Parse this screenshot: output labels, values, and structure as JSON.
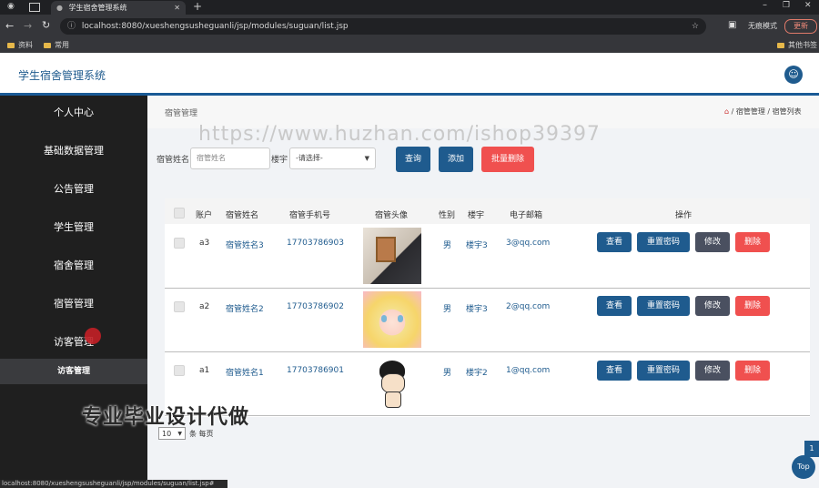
{
  "browser": {
    "tab_title": "学生宿舍管理系统",
    "url": "localhost:8080/xueshengsusheguanli/jsp/modules/suguan/list.jsp",
    "incognito_label": "无痕模式",
    "update_label": "更新",
    "bookmarks": [
      "资料",
      "常用"
    ],
    "bookmark_other": "其他书签"
  },
  "header": {
    "title": "学生宿舍管理系统"
  },
  "sidebar": {
    "items": [
      "个人中心",
      "基础数据管理",
      "公告管理",
      "学生管理",
      "宿舍管理",
      "宿管管理",
      "访客管理"
    ],
    "sub_item": "访客管理"
  },
  "breadcrumb": {
    "page_title": "宿管管理",
    "path": [
      "宿管管理",
      "宿管列表"
    ]
  },
  "watermark": "https://www.huzhan.com/ishop39397",
  "search": {
    "name_label": "宿管姓名",
    "name_placeholder": "宿管姓名",
    "building_label": "楼宇",
    "building_selected": "-请选择-",
    "query_label": "查询",
    "add_label": "添加",
    "batch_delete_label": "批量删除"
  },
  "table": {
    "columns": [
      "账户",
      "宿管姓名",
      "宿管手机号",
      "宿管头像",
      "性别",
      "楼宇",
      "电子邮箱",
      "操作"
    ],
    "rows": [
      {
        "account": "a3",
        "name": "宿管姓名3",
        "phone": "17703786903",
        "gender": "男",
        "building": "楼宇3",
        "email": "3@qq.com"
      },
      {
        "account": "a2",
        "name": "宿管姓名2",
        "phone": "17703786902",
        "gender": "男",
        "building": "楼宇3",
        "email": "2@qq.com"
      },
      {
        "account": "a1",
        "name": "宿管姓名1",
        "phone": "17703786901",
        "gender": "男",
        "building": "楼宇2",
        "email": "1@qq.com"
      }
    ],
    "actions": {
      "view": "查看",
      "reset_password": "重置密码",
      "edit": "修改",
      "delete": "删除"
    }
  },
  "caption": "专业毕业设计代做",
  "pager": {
    "page_size": "10",
    "per_page_label": "条 每页",
    "current_page": "1",
    "top_label": "Top"
  },
  "status_url": "localhost:8080/xueshengsusheguanli/jsp/modules/suguan/list.jsp#",
  "colors": {
    "primary": "#1f5b8e",
    "danger": "#f0504f",
    "sidebar_bg": "#1f1f1f"
  }
}
